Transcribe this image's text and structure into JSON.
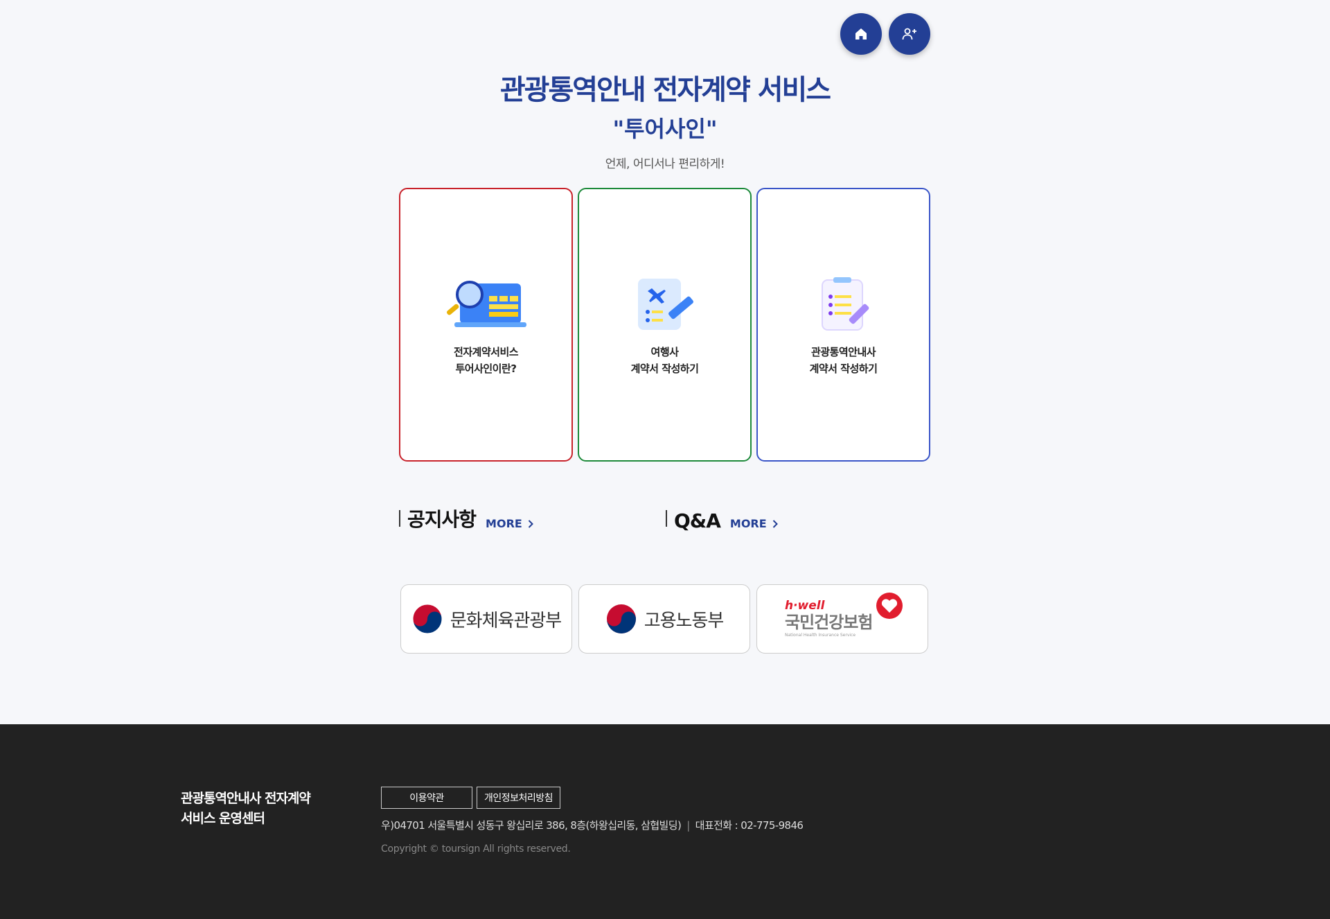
{
  "header": {
    "home_icon": "home-icon",
    "signup_icon": "user-plus-icon"
  },
  "hero": {
    "title": "관광통역안내 전자계약 서비스",
    "subtitle": "\"투어사인\"",
    "description": "언제, 어디서나 편리하게!"
  },
  "cards": [
    {
      "line1": "전자계약서비스",
      "line2": "투어사인이란?",
      "color": "#c8222a",
      "icon": "laptop-search-icon"
    },
    {
      "line1": "여행사",
      "line2": "계약서 작성하기",
      "color": "#1d8a3a",
      "icon": "travel-document-icon"
    },
    {
      "line1": "관광통역안내사",
      "line2": "계약서 작성하기",
      "color": "#3a55c8",
      "icon": "clipboard-pen-icon"
    }
  ],
  "boards": {
    "notice_title": "공지사항",
    "qna_title": "Q&A",
    "more_label": "MORE"
  },
  "partners": [
    {
      "name": "문화체육관광부"
    },
    {
      "name": "고용노동부"
    },
    {
      "brand": "h·well",
      "name": "국민건강보험",
      "sub": "National Health Insurance Service"
    }
  ],
  "footer": {
    "org_line1": "관광통역안내사 전자계약",
    "org_line2": "서비스 운영센터",
    "terms_label": "이용약관",
    "privacy_label": "개인정보처리방침",
    "address": "우)04701 서울특별시 성동구 왕십리로 386, 8층(하왕십리동, 삼협빌딩)",
    "phone": "대표전화 : 02-775-9846",
    "copyright": "Copyright © toursign All rights reserved."
  },
  "colors": {
    "primary": "#233f95",
    "footer_bg": "#222222"
  }
}
